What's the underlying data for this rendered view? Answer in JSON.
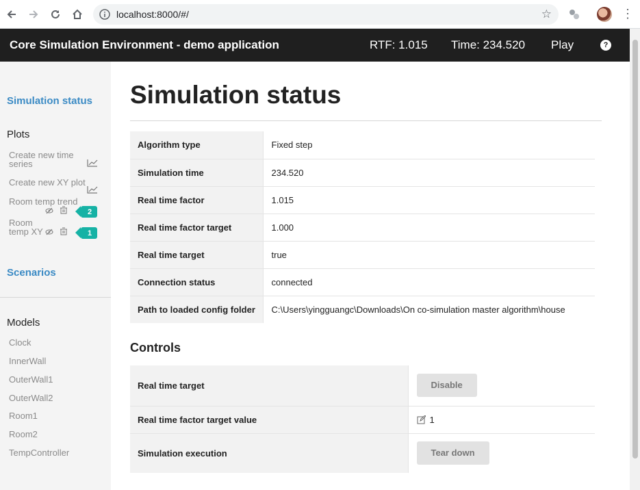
{
  "browser": {
    "url": "localhost:8000/#/"
  },
  "header": {
    "title": "Core Simulation Environment - demo application",
    "rtf": "RTF: 1.015",
    "time": "Time: 234.520",
    "play": "Play",
    "help": "?"
  },
  "sidebar": {
    "simulation_status": "Simulation status",
    "plots_heading": "Plots",
    "plot_actions": [
      {
        "label": "Create new time series",
        "icon": "line-chart-icon"
      },
      {
        "label": "Create new XY plot",
        "icon": "line-chart-icon"
      }
    ],
    "plots": [
      {
        "label": "Room temp trend",
        "badge": "2"
      },
      {
        "label": "Room temp XY",
        "badge": "1"
      }
    ],
    "scenarios": "Scenarios",
    "models_heading": "Models",
    "models": [
      "Clock",
      "InnerWall",
      "OuterWall1",
      "OuterWall2",
      "Room1",
      "Room2",
      "TempController"
    ]
  },
  "main": {
    "title": "Simulation status",
    "status_rows": [
      {
        "key": "Algorithm type",
        "value": "Fixed step"
      },
      {
        "key": "Simulation time",
        "value": "234.520"
      },
      {
        "key": "Real time factor",
        "value": "1.015"
      },
      {
        "key": "Real time factor target",
        "value": "1.000"
      },
      {
        "key": "Real time target",
        "value": "true"
      },
      {
        "key": "Connection status",
        "value": "connected"
      },
      {
        "key": "Path to loaded config folder",
        "value": "C:\\Users\\yingguangc\\Downloads\\On co-simulation master algorithm\\house"
      }
    ],
    "controls_heading": "Controls",
    "controls": {
      "real_time_target_label": "Real time target",
      "real_time_target_button": "Disable",
      "rtf_target_value_label": "Real time factor target value",
      "rtf_target_value": "1",
      "sim_execution_label": "Simulation execution",
      "sim_execution_button": "Tear down"
    }
  },
  "colors": {
    "header_bg": "#1f1f1f",
    "link": "#3a8ac4",
    "badge": "#16b2a5"
  }
}
